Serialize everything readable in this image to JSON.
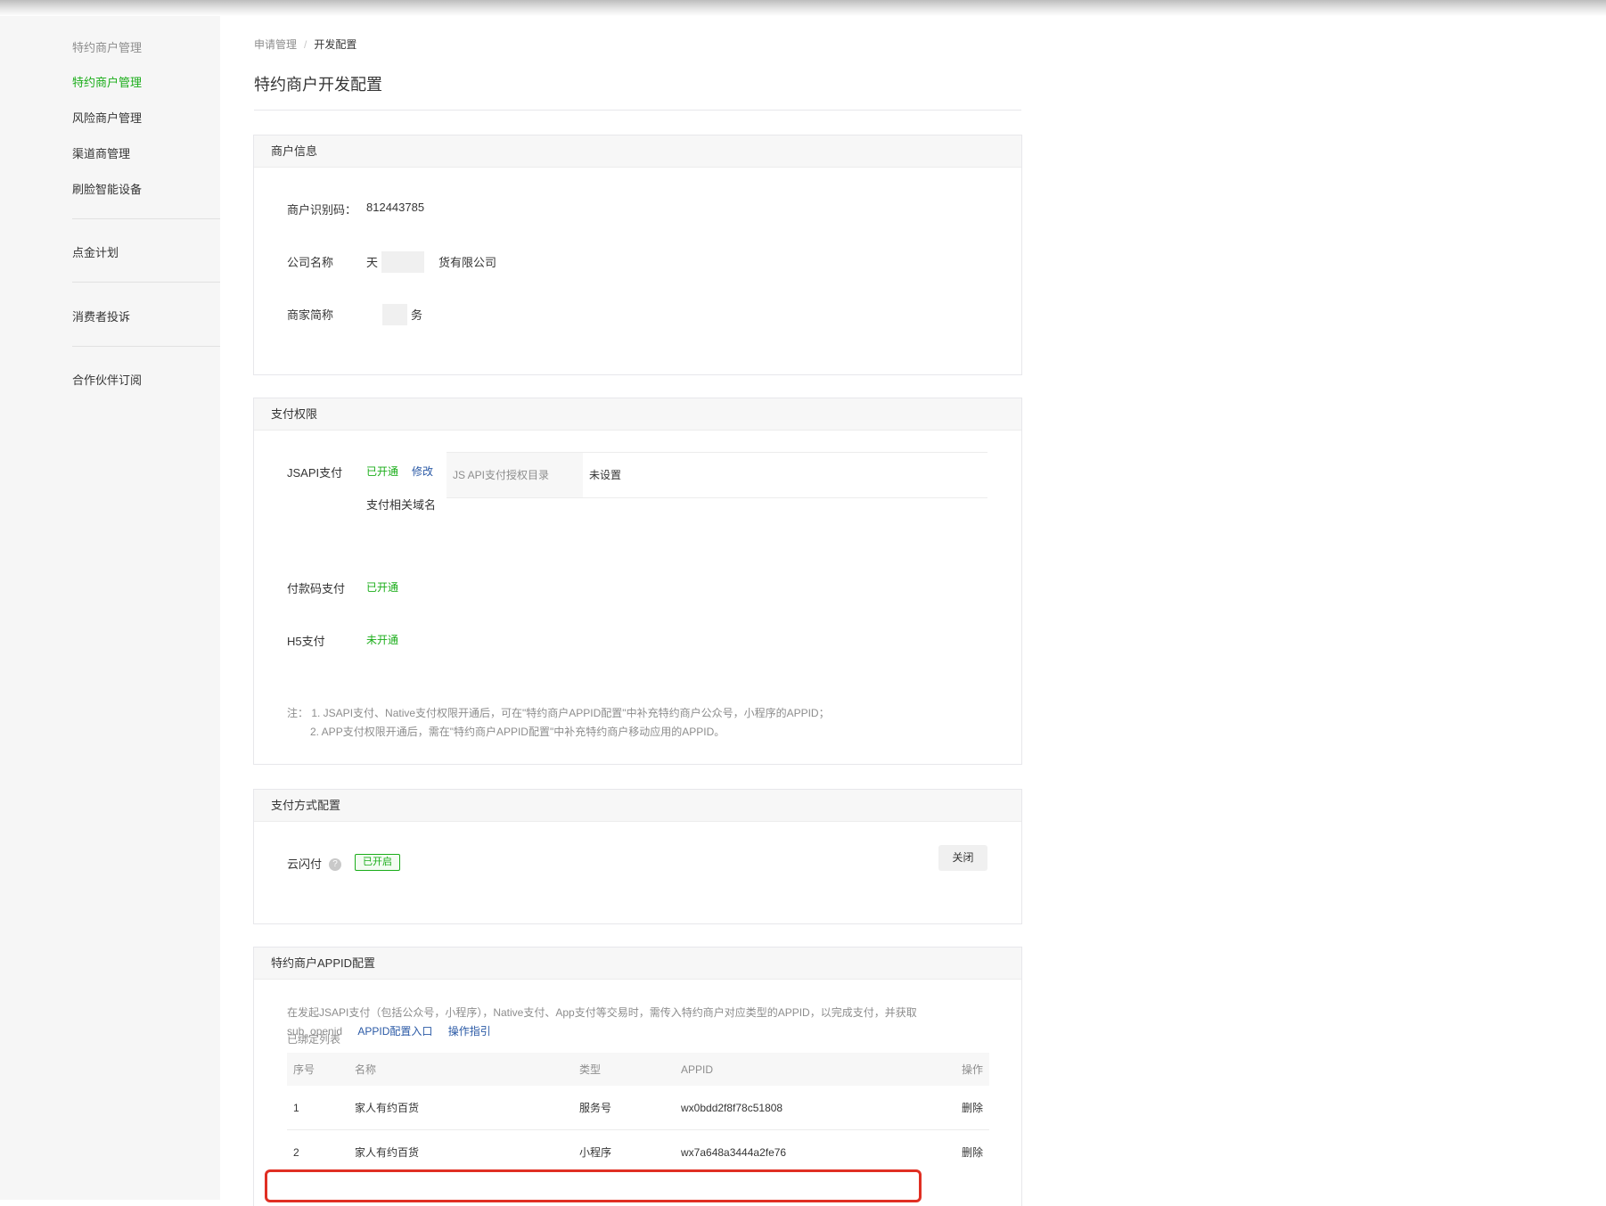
{
  "sidebar": {
    "section_title": "特约商户管理",
    "items": [
      {
        "label": "特约商户管理"
      },
      {
        "label": "风险商户管理"
      },
      {
        "label": "渠道商管理"
      },
      {
        "label": "刷脸智能设备"
      },
      {
        "label": "点金计划"
      },
      {
        "label": "消费者投诉"
      },
      {
        "label": "合作伙伴订阅"
      }
    ]
  },
  "breadcrumb": {
    "parent": "申请管理",
    "separator": "/",
    "current": "开发配置"
  },
  "page_title": "特约商户开发配置",
  "merchant_info": {
    "header": "商户信息",
    "id_label": "商户识别码：",
    "id_value": "812443785",
    "company_label": "公司名称",
    "company_value_start": "天",
    "company_value_end": "货有限公司",
    "short_label": "商家简称",
    "short_value_end": "务"
  },
  "pay_permissions": {
    "header": "支付权限",
    "jsapi_label": "JSAPI支付",
    "jsapi_status": "已开通",
    "jsapi_edit": "修改",
    "domain_label": "支付相关域名",
    "domain_key": "JS API支付授权目录",
    "domain_value": "未设置",
    "code_label": "付款码支付",
    "code_status": "已开通",
    "h5_label": "H5支付",
    "h5_status": "未开通",
    "note_line1": "注： 1. JSAPI支付、Native支付权限开通后，可在\"特约商户APPID配置\"中补充特约商户公众号，小程序的APPID；",
    "note_line2": "2. APP支付权限开通后，需在\"特约商户APPID配置\"中补充特约商户移动应用的APPID。"
  },
  "pay_methods": {
    "header": "支付方式配置",
    "item_label": "云闪付",
    "help_icon": "?",
    "status_badge": "已开启",
    "close_button": "关闭"
  },
  "appid_config": {
    "header": "特约商户APPID配置",
    "desc_line1": "在发起JSAPI支付（包括公众号，小程序），Native支付、App支付等交易时，需传入特约商户对应类型的APPID，以完成支付，并获取",
    "desc_line2": "sub_openid",
    "link_entry": "APPID配置入口",
    "link_guide": "操作指引",
    "list_title": "已绑定列表",
    "columns": [
      "序号",
      "名称",
      "类型",
      "APPID",
      "操作"
    ],
    "rows": [
      {
        "no": "1",
        "name": "家人有约百货",
        "type": "服务号",
        "appid": "wx0bdd2f8f78c51808",
        "action": "删除"
      },
      {
        "no": "2",
        "name": "家人有约百货",
        "type": "小程序",
        "appid": "wx7a648a3444a2fe76",
        "action": "删除"
      }
    ]
  },
  "colors": {
    "accent_green": "#1aad19",
    "link_blue": "#2b5aa6",
    "highlight_red": "#e02f23"
  }
}
